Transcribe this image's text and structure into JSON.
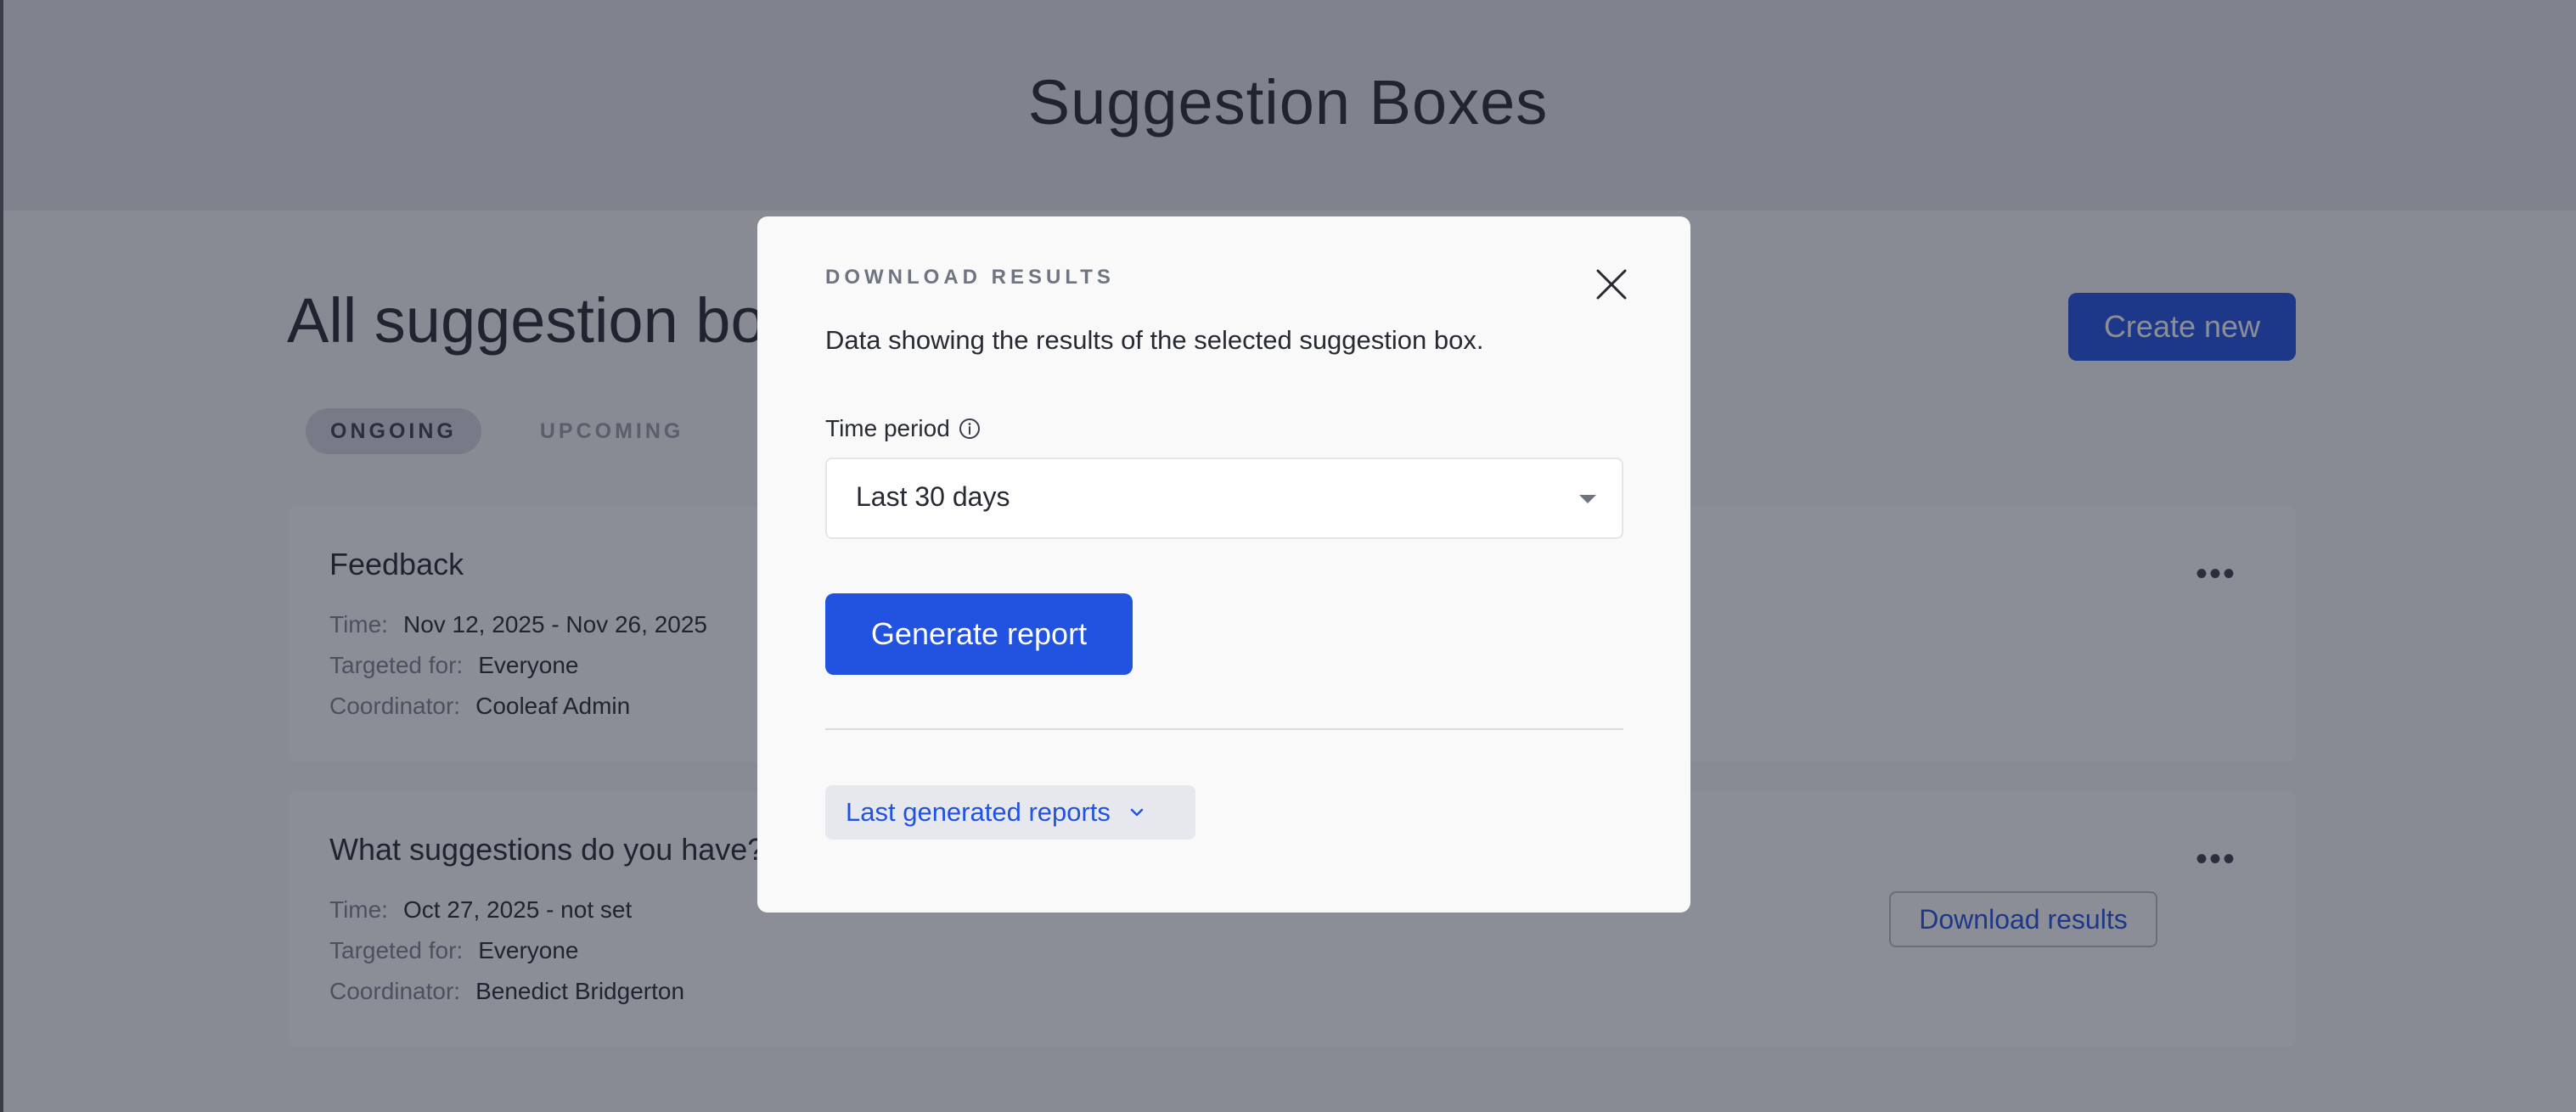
{
  "page": {
    "title": "Suggestion Boxes",
    "section_title": "All suggestion boxes",
    "create_label": "Create new",
    "tabs": [
      {
        "label": "ONGOING",
        "active": true
      },
      {
        "label": "UPCOMING",
        "active": false
      }
    ],
    "cards": [
      {
        "title": "Feedback",
        "time_label": "Time:",
        "time_value": "Nov 12, 2025 - Nov 26, 2025",
        "target_label": "Targeted for:",
        "target_value": "Everyone",
        "coord_label": "Coordinator:",
        "coord_value": "Cooleaf Admin",
        "more_icon": "more-icon"
      },
      {
        "title": "What suggestions do you have?",
        "time_label": "Time:",
        "time_value": "Oct 27, 2025 - not set",
        "target_label": "Targeted for:",
        "target_value": "Everyone",
        "coord_label": "Coordinator:",
        "coord_value": "Benedict Bridgerton",
        "download_label": "Download results",
        "more_icon": "more-icon"
      }
    ]
  },
  "modal": {
    "heading": "DOWNLOAD RESULTS",
    "description": "Data showing the results of the selected suggestion box.",
    "time_period_label": "Time period",
    "time_period_value": "Last 30 days",
    "generate_label": "Generate report",
    "last_reports_label": "Last generated reports",
    "close_icon": "close-icon",
    "info_icon": "info-icon"
  },
  "colors": {
    "accent": "#2152e0",
    "overlay": "rgba(26,30,48,0.5)",
    "header_bg": "#e6e7ec",
    "modal_bg": "#f9f9fa"
  }
}
